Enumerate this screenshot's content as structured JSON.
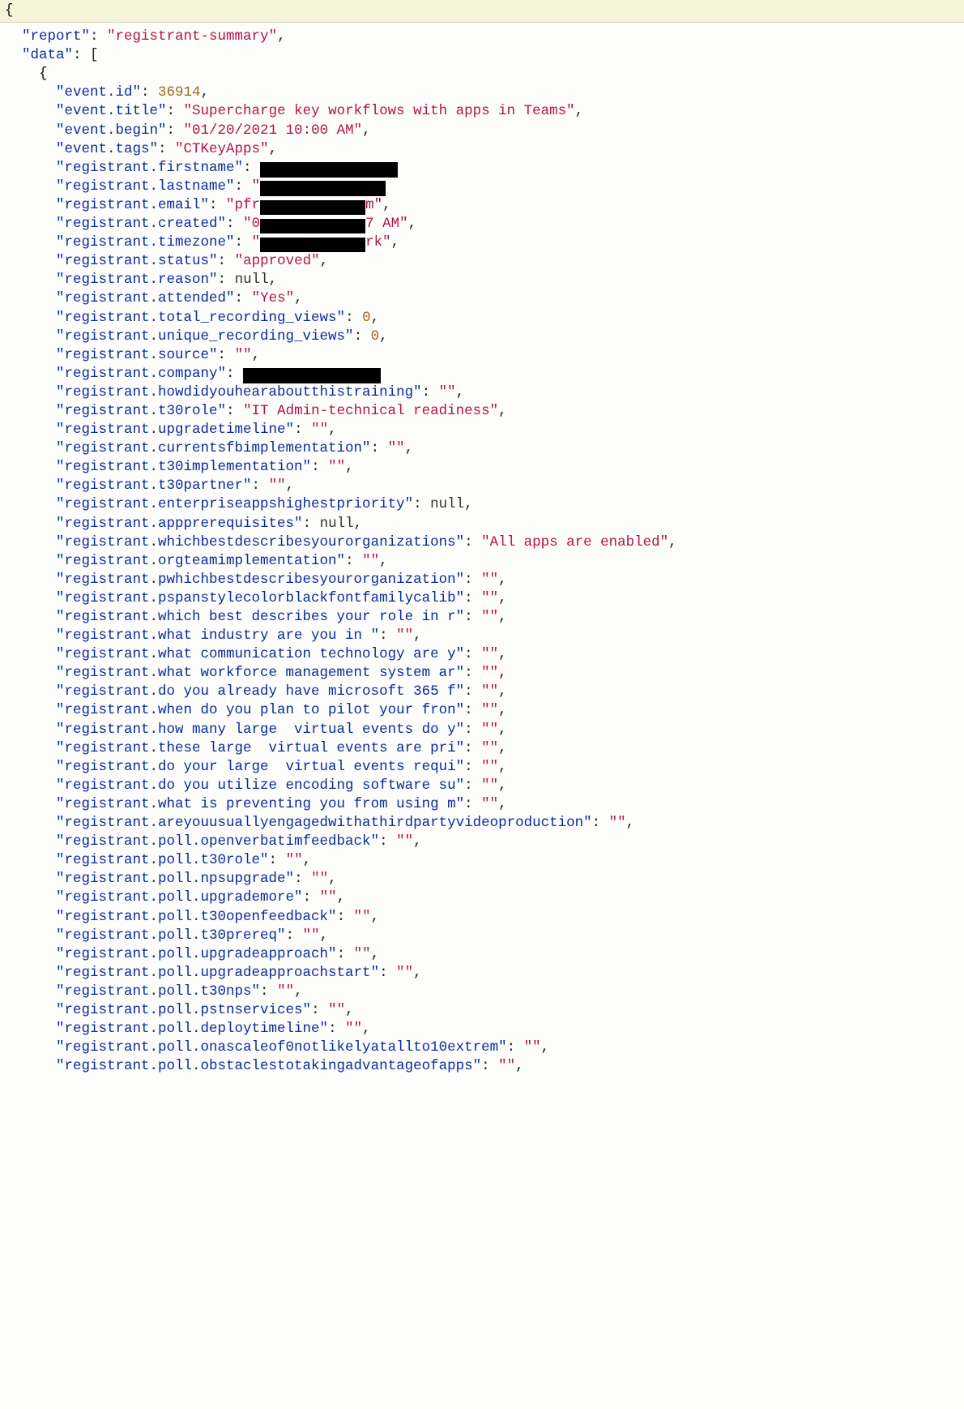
{
  "topbar_open_brace": "{",
  "lines": [
    {
      "indent": 1,
      "key": "\"report\"",
      "sep": ": ",
      "val": "\"registrant-summary\"",
      "valClass": "s",
      "tail": ","
    },
    {
      "indent": 1,
      "key": "\"data\"",
      "sep": ": ",
      "val": "[",
      "valClass": "p",
      "tail": ""
    },
    {
      "indent": 2,
      "raw": "{",
      "rawClass": "brace"
    },
    {
      "indent": 3,
      "key": "\"event.id\"",
      "sep": ": ",
      "val": "36914",
      "valClass": "n",
      "tail": ","
    },
    {
      "indent": 3,
      "key": "\"event.title\"",
      "sep": ": ",
      "val": "\"Supercharge key workflows with apps in Teams\"",
      "valClass": "s",
      "tail": ","
    },
    {
      "indent": 3,
      "key": "\"event.begin\"",
      "sep": ": ",
      "val": "\"01/20/2021 10:00 AM\"",
      "valClass": "s",
      "tail": ","
    },
    {
      "indent": 3,
      "key": "\"event.tags\"",
      "sep": ": ",
      "val": "\"CTKeyApps\"",
      "valClass": "s",
      "tail": ","
    },
    {
      "indent": 3,
      "key": "\"registrant.firstname\"",
      "sep": ": ",
      "redact": 170,
      "tail": ""
    },
    {
      "indent": 3,
      "key": "\"registrant.lastname\"",
      "sep": ": ",
      "pre": "\"",
      "preClass": "s",
      "redactAfterPre": 155,
      "tail": ""
    },
    {
      "indent": 3,
      "key": "\"registrant.email\"",
      "sep": ": ",
      "pre": "\"pfr",
      "preClass": "s",
      "redactAfterPre": 130,
      "post": "m\"",
      "postClass": "s",
      "tail": ","
    },
    {
      "indent": 3,
      "key": "\"registrant.created\"",
      "sep": ": ",
      "pre": "\"0",
      "preClass": "s",
      "redactAfterPre": 130,
      "post": "7 AM\"",
      "postClass": "s",
      "tail": ","
    },
    {
      "indent": 3,
      "key": "\"registrant.timezone\"",
      "sep": ": ",
      "pre": "\"",
      "preClass": "s",
      "redactAfterPre": 130,
      "post": "rk\"",
      "postClass": "s",
      "tail": ","
    },
    {
      "indent": 3,
      "key": "\"registrant.status\"",
      "sep": ": ",
      "val": "\"approved\"",
      "valClass": "s",
      "tail": ","
    },
    {
      "indent": 3,
      "key": "\"registrant.reason\"",
      "sep": ": ",
      "val": "null",
      "valClass": "nl",
      "tail": ","
    },
    {
      "indent": 3,
      "key": "\"registrant.attended\"",
      "sep": ": ",
      "val": "\"Yes\"",
      "valClass": "s",
      "tail": ","
    },
    {
      "indent": 3,
      "key": "\"registrant.total_recording_views\"",
      "sep": ": ",
      "val": "0",
      "valClass": "n",
      "tail": ","
    },
    {
      "indent": 3,
      "key": "\"registrant.unique_recording_views\"",
      "sep": ": ",
      "val": "0",
      "valClass": "n",
      "tail": ","
    },
    {
      "indent": 3,
      "key": "\"registrant.source\"",
      "sep": ": ",
      "val": "\"\"",
      "valClass": "s",
      "tail": ","
    },
    {
      "indent": 3,
      "key": "\"registrant.company\"",
      "sep": ": ",
      "redact": 170,
      "tail": ""
    },
    {
      "indent": 3,
      "key": "\"registrant.howdidyouhearaboutthistraining\"",
      "sep": ": ",
      "val": "\"\"",
      "valClass": "s",
      "tail": ","
    },
    {
      "indent": 3,
      "key": "\"registrant.t30role\"",
      "sep": ": ",
      "val": "\"IT Admin-technical readiness\"",
      "valClass": "s",
      "tail": ","
    },
    {
      "indent": 3,
      "key": "\"registrant.upgradetimeline\"",
      "sep": ": ",
      "val": "\"\"",
      "valClass": "s",
      "tail": ","
    },
    {
      "indent": 3,
      "key": "\"registrant.currentsfbimplementation\"",
      "sep": ": ",
      "val": "\"\"",
      "valClass": "s",
      "tail": ","
    },
    {
      "indent": 3,
      "key": "\"registrant.t30implementation\"",
      "sep": ": ",
      "val": "\"\"",
      "valClass": "s",
      "tail": ","
    },
    {
      "indent": 3,
      "key": "\"registrant.t30partner\"",
      "sep": ": ",
      "val": "\"\"",
      "valClass": "s",
      "tail": ","
    },
    {
      "indent": 3,
      "key": "\"registrant.enterpriseappshighestpriority\"",
      "sep": ": ",
      "val": "null",
      "valClass": "nl",
      "tail": ","
    },
    {
      "indent": 3,
      "key": "\"registrant.appprerequisites\"",
      "sep": ": ",
      "val": "null",
      "valClass": "nl",
      "tail": ","
    },
    {
      "indent": 3,
      "key": "\"registrant.whichbestdescribesyourorganizations\"",
      "sep": ": ",
      "val": "\"All apps are enabled\"",
      "valClass": "s",
      "tail": ","
    },
    {
      "indent": 3,
      "key": "\"registrant.orgteamimplementation\"",
      "sep": ": ",
      "val": "\"\"",
      "valClass": "s",
      "tail": ","
    },
    {
      "indent": 3,
      "key": "\"registrant.pwhichbestdescribesyourorganization\"",
      "sep": ": ",
      "val": "\"\"",
      "valClass": "s",
      "tail": ","
    },
    {
      "indent": 3,
      "key": "\"registrant.pspanstylecolorblackfontfamilycalib\"",
      "sep": ": ",
      "val": "\"\"",
      "valClass": "s",
      "tail": ","
    },
    {
      "indent": 3,
      "key": "\"registrant.which best describes your role in r\"",
      "sep": ": ",
      "val": "\"\"",
      "valClass": "s",
      "tail": ","
    },
    {
      "indent": 3,
      "key": "\"registrant.what industry are you in \"",
      "sep": ": ",
      "val": "\"\"",
      "valClass": "s",
      "tail": ","
    },
    {
      "indent": 3,
      "key": "\"registrant.what communication technology are y\"",
      "sep": ": ",
      "val": "\"\"",
      "valClass": "s",
      "tail": ","
    },
    {
      "indent": 3,
      "key": "\"registrant.what workforce management system ar\"",
      "sep": ": ",
      "val": "\"\"",
      "valClass": "s",
      "tail": ","
    },
    {
      "indent": 3,
      "key": "\"registrant.do you already have microsoft 365 f\"",
      "sep": ": ",
      "val": "\"\"",
      "valClass": "s",
      "tail": ","
    },
    {
      "indent": 3,
      "key": "\"registrant.when do you plan to pilot your fron\"",
      "sep": ": ",
      "val": "\"\"",
      "valClass": "s",
      "tail": ","
    },
    {
      "indent": 3,
      "key": "\"registrant.how many large  virtual events do y\"",
      "sep": ": ",
      "val": "\"\"",
      "valClass": "s",
      "tail": ","
    },
    {
      "indent": 3,
      "key": "\"registrant.these large  virtual events are pri\"",
      "sep": ": ",
      "val": "\"\"",
      "valClass": "s",
      "tail": ","
    },
    {
      "indent": 3,
      "key": "\"registrant.do your large  virtual events requi\"",
      "sep": ": ",
      "val": "\"\"",
      "valClass": "s",
      "tail": ","
    },
    {
      "indent": 3,
      "key": "\"registrant.do you utilize encoding software su\"",
      "sep": ": ",
      "val": "\"\"",
      "valClass": "s",
      "tail": ","
    },
    {
      "indent": 3,
      "key": "\"registrant.what is preventing you from using m\"",
      "sep": ": ",
      "val": "\"\"",
      "valClass": "s",
      "tail": ","
    },
    {
      "indent": 3,
      "key": "\"registrant.areyouusuallyengagedwithathirdpartyvideoproduction\"",
      "sep": ": ",
      "val": "\"\"",
      "valClass": "s",
      "tail": ","
    },
    {
      "indent": 3,
      "key": "\"registrant.poll.openverbatimfeedback\"",
      "sep": ": ",
      "val": "\"\"",
      "valClass": "s",
      "tail": ","
    },
    {
      "indent": 3,
      "key": "\"registrant.poll.t30role\"",
      "sep": ": ",
      "val": "\"\"",
      "valClass": "s",
      "tail": ","
    },
    {
      "indent": 3,
      "key": "\"registrant.poll.npsupgrade\"",
      "sep": ": ",
      "val": "\"\"",
      "valClass": "s",
      "tail": ","
    },
    {
      "indent": 3,
      "key": "\"registrant.poll.upgrademore\"",
      "sep": ": ",
      "val": "\"\"",
      "valClass": "s",
      "tail": ","
    },
    {
      "indent": 3,
      "key": "\"registrant.poll.t30openfeedback\"",
      "sep": ": ",
      "val": "\"\"",
      "valClass": "s",
      "tail": ","
    },
    {
      "indent": 3,
      "key": "\"registrant.poll.t30prereq\"",
      "sep": ": ",
      "val": "\"\"",
      "valClass": "s",
      "tail": ","
    },
    {
      "indent": 3,
      "key": "\"registrant.poll.upgradeapproach\"",
      "sep": ": ",
      "val": "\"\"",
      "valClass": "s",
      "tail": ","
    },
    {
      "indent": 3,
      "key": "\"registrant.poll.upgradeapproachstart\"",
      "sep": ": ",
      "val": "\"\"",
      "valClass": "s",
      "tail": ","
    },
    {
      "indent": 3,
      "key": "\"registrant.poll.t30nps\"",
      "sep": ": ",
      "val": "\"\"",
      "valClass": "s",
      "tail": ","
    },
    {
      "indent": 3,
      "key": "\"registrant.poll.pstnservices\"",
      "sep": ": ",
      "val": "\"\"",
      "valClass": "s",
      "tail": ","
    },
    {
      "indent": 3,
      "key": "\"registrant.poll.deploytimeline\"",
      "sep": ": ",
      "val": "\"\"",
      "valClass": "s",
      "tail": ","
    },
    {
      "indent": 3,
      "key": "\"registrant.poll.onascaleof0notlikelyatallto10extrem\"",
      "sep": ": ",
      "val": "\"\"",
      "valClass": "s",
      "tail": ","
    },
    {
      "indent": 3,
      "key": "\"registrant.poll.obstaclestotakingadvantageofapps\"",
      "sep": ": ",
      "val": "\"\"",
      "valClass": "s",
      "tail": ","
    }
  ]
}
